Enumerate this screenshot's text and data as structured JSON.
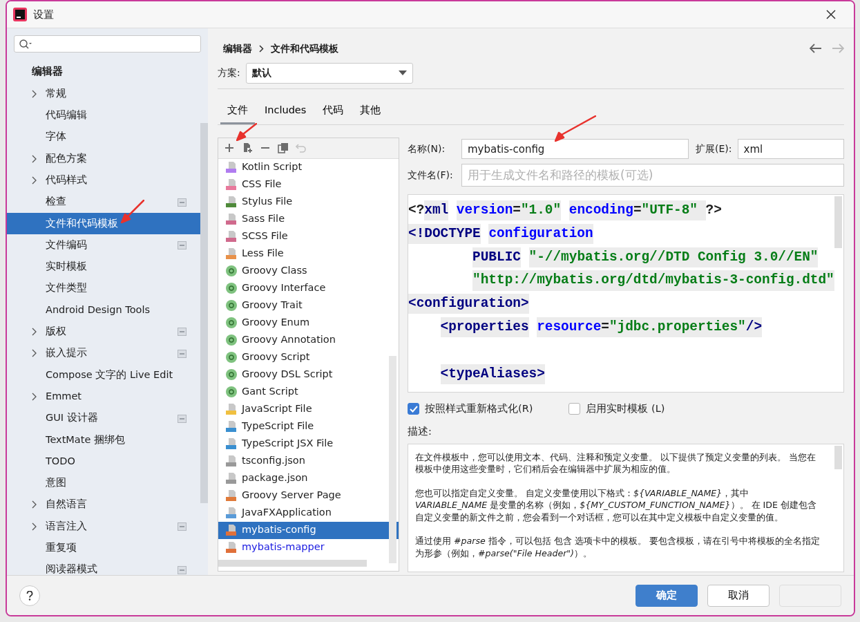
{
  "window": {
    "title": "设置"
  },
  "sidebar": {
    "items": [
      {
        "label": "编辑器",
        "children": [
          {
            "label": "常规",
            "expandable": true,
            "project_scoped": false,
            "selected": false
          },
          {
            "label": "代码编辑",
            "expandable": false,
            "project_scoped": false,
            "selected": false
          },
          {
            "label": "字体",
            "expandable": false,
            "project_scoped": false,
            "selected": false
          },
          {
            "label": "配色方案",
            "expandable": true,
            "project_scoped": false,
            "selected": false
          },
          {
            "label": "代码样式",
            "expandable": true,
            "project_scoped": false,
            "selected": false
          },
          {
            "label": "检查",
            "expandable": false,
            "project_scoped": true,
            "selected": false
          },
          {
            "label": "文件和代码模板",
            "expandable": false,
            "project_scoped": false,
            "selected": true,
            "arrow_mark": true
          },
          {
            "label": "文件编码",
            "expandable": false,
            "project_scoped": true,
            "selected": false
          },
          {
            "label": "实时模板",
            "expandable": false,
            "project_scoped": false,
            "selected": false
          },
          {
            "label": "文件类型",
            "expandable": false,
            "project_scoped": false,
            "selected": false
          },
          {
            "label": "Android Design Tools",
            "expandable": false,
            "project_scoped": false,
            "selected": false
          },
          {
            "label": "版权",
            "expandable": true,
            "project_scoped": true,
            "selected": false
          },
          {
            "label": "嵌入提示",
            "expandable": true,
            "project_scoped": true,
            "selected": false
          },
          {
            "label": "Compose 文字的 Live Edit",
            "expandable": false,
            "project_scoped": false,
            "selected": false
          },
          {
            "label": "Emmet",
            "expandable": true,
            "project_scoped": false,
            "selected": false
          },
          {
            "label": "GUI 设计器",
            "expandable": false,
            "project_scoped": true,
            "selected": false
          },
          {
            "label": "TextMate 捆绑包",
            "expandable": false,
            "project_scoped": false,
            "selected": false
          },
          {
            "label": "TODO",
            "expandable": false,
            "project_scoped": false,
            "selected": false
          },
          {
            "label": "意图",
            "expandable": false,
            "project_scoped": false,
            "selected": false
          },
          {
            "label": "自然语言",
            "expandable": true,
            "project_scoped": false,
            "selected": false
          },
          {
            "label": "语言注入",
            "expandable": true,
            "project_scoped": true,
            "selected": false
          },
          {
            "label": "重复项",
            "expandable": false,
            "project_scoped": false,
            "selected": false
          },
          {
            "label": "阅读器模式",
            "expandable": false,
            "project_scoped": true,
            "selected": false
          }
        ]
      }
    ]
  },
  "breadcrumb": [
    "编辑器",
    "文件和代码模板"
  ],
  "scheme": {
    "label": "方案:",
    "value": "默认"
  },
  "tabs": [
    {
      "label": "文件",
      "selected": true
    },
    {
      "label": "Includes",
      "selected": false
    },
    {
      "label": "代码",
      "selected": false
    },
    {
      "label": "其他",
      "selected": false
    }
  ],
  "toolbar": [
    {
      "kind": "add",
      "disabled": false,
      "arrow_mark": true
    },
    {
      "kind": "copy-add",
      "disabled": false
    },
    {
      "kind": "remove",
      "disabled": false
    },
    {
      "kind": "duplicate",
      "disabled": false
    },
    {
      "kind": "reset",
      "disabled": true
    }
  ],
  "templates": [
    {
      "label": "Kotlin Script",
      "kind": "kotlin",
      "selected": false,
      "custom": false
    },
    {
      "label": "CSS File",
      "kind": "css",
      "selected": false,
      "custom": false
    },
    {
      "label": "Stylus File",
      "kind": "styl",
      "selected": false,
      "custom": false
    },
    {
      "label": "Sass File",
      "kind": "sass",
      "selected": false,
      "custom": false
    },
    {
      "label": "SCSS File",
      "kind": "sass",
      "selected": false,
      "custom": false
    },
    {
      "label": "Less File",
      "kind": "less",
      "selected": false,
      "custom": false
    },
    {
      "label": "Groovy Class",
      "kind": "groovy",
      "selected": false,
      "custom": false
    },
    {
      "label": "Groovy Interface",
      "kind": "groovy",
      "selected": false,
      "custom": false
    },
    {
      "label": "Groovy Trait",
      "kind": "groovy",
      "selected": false,
      "custom": false
    },
    {
      "label": "Groovy Enum",
      "kind": "groovy",
      "selected": false,
      "custom": false
    },
    {
      "label": "Groovy Annotation",
      "kind": "groovy",
      "selected": false,
      "custom": false
    },
    {
      "label": "Groovy Script",
      "kind": "groovy",
      "selected": false,
      "custom": false
    },
    {
      "label": "Groovy DSL Script",
      "kind": "groovy",
      "selected": false,
      "custom": false
    },
    {
      "label": "Gant Script",
      "kind": "groovy",
      "selected": false,
      "custom": false
    },
    {
      "label": "JavaScript File",
      "kind": "js",
      "selected": false,
      "custom": false
    },
    {
      "label": "TypeScript File",
      "kind": "ts",
      "selected": false,
      "custom": false
    },
    {
      "label": "TypeScript JSX File",
      "kind": "ts",
      "selected": false,
      "custom": false
    },
    {
      "label": "tsconfig.json",
      "kind": "json",
      "selected": false,
      "custom": false
    },
    {
      "label": "package.json",
      "kind": "json",
      "selected": false,
      "custom": false
    },
    {
      "label": "Groovy Server Page",
      "kind": "gsp",
      "selected": false,
      "custom": false
    },
    {
      "label": "JavaFXApplication",
      "kind": "java",
      "selected": false,
      "custom": false
    },
    {
      "label": "mybatis-config",
      "kind": "xml",
      "selected": true,
      "custom": true
    },
    {
      "label": "mybatis-mapper",
      "kind": "xml",
      "selected": false,
      "custom": true
    }
  ],
  "form": {
    "name": {
      "label": "名称(N):",
      "value": "mybatis-config",
      "arrow_mark": true
    },
    "extension": {
      "label": "扩展(E):",
      "value": "xml"
    },
    "file_name": {
      "label": "文件名(F):",
      "placeholder": "用于生成文件名和路径的模板(可选)"
    }
  },
  "code": [
    {
      "kind": "code",
      "tokens": [
        {
          "text": "<?",
          "kind": "plain",
          "shaded": false
        },
        {
          "text": "xml",
          "kind": "tag",
          "shaded": true
        },
        {
          "text": " version",
          "kind": "attr",
          "shaded": true
        },
        {
          "text": "=",
          "kind": "plain",
          "shaded": true
        },
        {
          "text": "\"1.0\"",
          "kind": "value",
          "shaded": true
        },
        {
          "text": " encoding",
          "kind": "attr",
          "shaded": true
        },
        {
          "text": "=",
          "kind": "plain",
          "shaded": true
        },
        {
          "text": "\"UTF-8\" ",
          "kind": "value",
          "shaded": true
        },
        {
          "text": "?>",
          "kind": "plain",
          "shaded": false
        }
      ]
    },
    {
      "kind": "code",
      "tokens": [
        {
          "text": "<!DOCTYPE",
          "kind": "tag",
          "shaded": true
        },
        {
          "text": " configuration",
          "kind": "attr",
          "shaded": true
        }
      ]
    },
    {
      "kind": "code",
      "tokens": [
        {
          "text": "        PUBLIC",
          "kind": "tag",
          "shaded": true
        },
        {
          "text": " \"-//mybatis.org//DTD Config 3.0//EN\"",
          "kind": "value",
          "shaded": true
        }
      ]
    },
    {
      "kind": "code",
      "tokens": [
        {
          "text": "        \"http://mybatis.org/dtd/mybatis-3-config.dtd\"",
          "kind": "value",
          "shaded": true
        }
      ]
    },
    {
      "kind": "code",
      "tokens": [
        {
          "text": "<configuration>",
          "kind": "tag",
          "shaded": true
        }
      ]
    },
    {
      "kind": "code",
      "tokens": [
        {
          "text": "    <properties",
          "kind": "tag",
          "shaded": true
        },
        {
          "text": " resource",
          "kind": "attr",
          "shaded": true
        },
        {
          "text": "=",
          "kind": "plain",
          "shaded": true
        },
        {
          "text": "\"jdbc.properties\"",
          "kind": "value",
          "shaded": true
        },
        {
          "text": "/>",
          "kind": "tag",
          "shaded": true
        }
      ]
    },
    {
      "kind": "blank"
    },
    {
      "kind": "code",
      "tokens": [
        {
          "text": "    <typeAliases>",
          "kind": "tag",
          "shaded": true
        }
      ]
    }
  ],
  "options": [
    {
      "label": "按照样式重新格式化(R)",
      "checked": true
    },
    {
      "label": "启用实时模板 (L)",
      "checked": false
    }
  ],
  "description": {
    "label": "描述:",
    "paragraphs": [
      "在文件模板中，您可以使用文本、代码、注释和预定义变量。 以下提供了预定义变量的列表。 当您在模板中使用这些变量时，它们稍后会在编辑器中扩展为相应的值。",
      "您也可以指定自定义变量。 自定义变量使用以下格式：*${VARIABLE_NAME}*，其中 *VARIABLE_NAME* 是变量的名称（例如，*${MY_CUSTOM_FUNCTION_NAME}*）。 在 IDE 创建包含自定义变量的新文件之前，您会看到一个对话框，您可以在其中定义模板中自定义变量的值。",
      "通过使用 *#parse* 指令，可以包括 包含 选项卡中的模板。 要包含模板，请在引号中将模板的全名指定为形参（例如，*#parse(\"File Header\")*）。"
    ]
  },
  "buttons": [
    {
      "label": "确定",
      "kind": "primary",
      "disabled": false
    },
    {
      "label": "取消",
      "kind": "default",
      "disabled": false
    },
    {
      "kind": "default",
      "disabled": true
    }
  ]
}
